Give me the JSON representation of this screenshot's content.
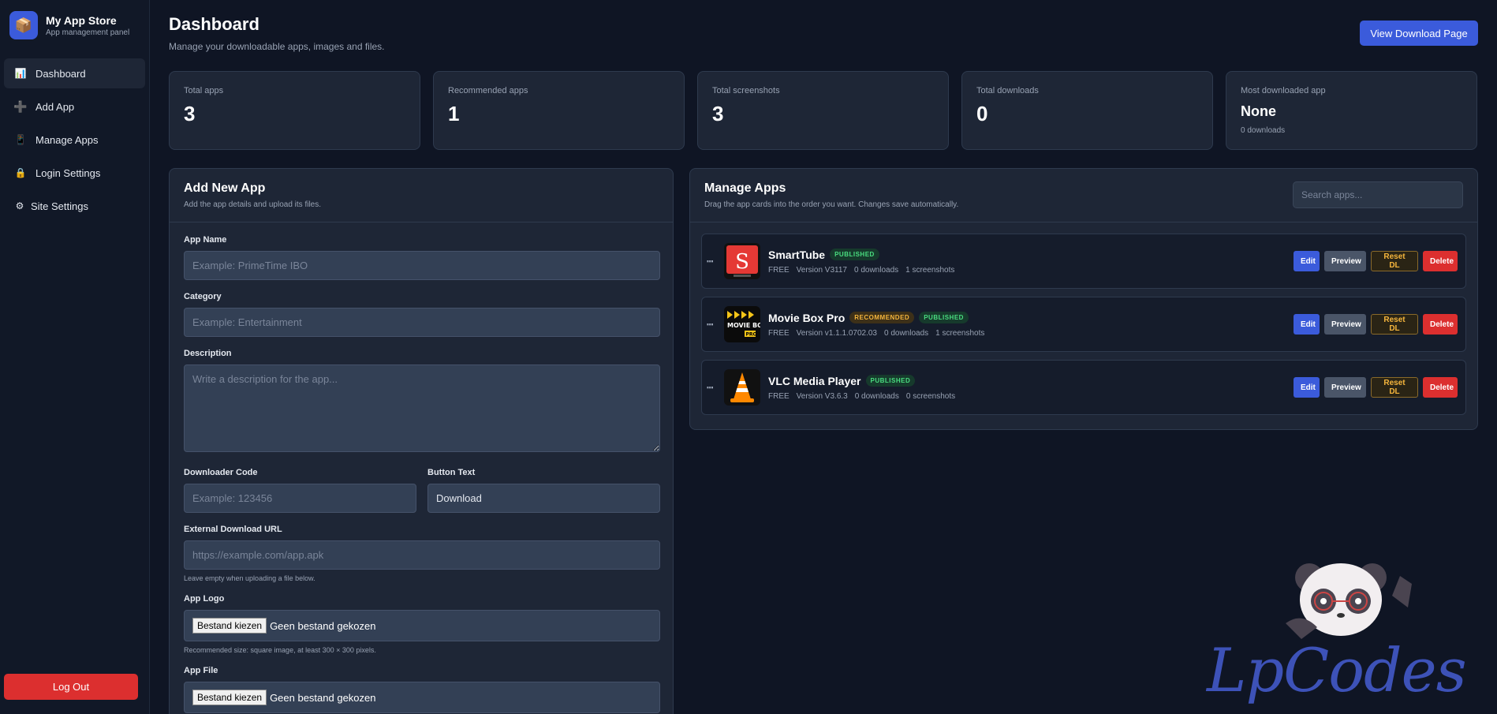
{
  "brand": {
    "title": "My App Store",
    "subtitle": "App management panel"
  },
  "nav": [
    {
      "label": "Dashboard",
      "icon": "chart-icon",
      "glyph": "📊",
      "active": true
    },
    {
      "label": "Add App",
      "icon": "plus-icon",
      "glyph": "➕"
    },
    {
      "label": "Manage Apps",
      "icon": "clipboard-icon",
      "glyph": "📱"
    },
    {
      "label": "Login Settings",
      "icon": "lock-icon",
      "glyph": "🔒"
    },
    {
      "label": "Site Settings",
      "icon": "gear-icon",
      "glyph": "⚙"
    }
  ],
  "logout_label": "Log Out",
  "header": {
    "title": "Dashboard",
    "subtitle": "Manage your downloadable apps, images and files.",
    "view_button": "View Download Page"
  },
  "stats": [
    {
      "label": "Total apps",
      "value": "3"
    },
    {
      "label": "Recommended apps",
      "value": "1"
    },
    {
      "label": "Total screenshots",
      "value": "3"
    },
    {
      "label": "Total downloads",
      "value": "0"
    },
    {
      "label": "Most downloaded app",
      "value": "None",
      "note": "0 downloads"
    }
  ],
  "add_form": {
    "title": "Add New App",
    "subtitle": "Add the app details and upload its files.",
    "app_name_label": "App Name",
    "app_name_placeholder": "Example: PrimeTime IBO",
    "category_label": "Category",
    "category_placeholder": "Example: Entertainment",
    "description_label": "Description",
    "description_placeholder": "Write a description for the app...",
    "downloader_label": "Downloader Code",
    "downloader_placeholder": "Example: 123456",
    "button_text_label": "Button Text",
    "button_text_value": "Download",
    "url_label": "External Download URL",
    "url_placeholder": "https://example.com/app.apk",
    "url_hint": "Leave empty when uploading a file below.",
    "logo_label": "App Logo",
    "file_button": "Bestand kiezen",
    "file_none": "Geen bestand gekozen",
    "logo_hint": "Recommended size: square image, at least 300 × 300 pixels.",
    "app_file_label": "App File"
  },
  "manage": {
    "title": "Manage Apps",
    "subtitle": "Drag the app cards into the order you want. Changes save automatically.",
    "search_placeholder": "Search apps...",
    "apps": [
      {
        "name": "SmartTube",
        "badges": [
          "PUBLISHED"
        ],
        "price": "FREE",
        "version": "Version V3117",
        "downloads": "0 downloads",
        "screenshots": "1 screenshots",
        "icon": "smarttube-icon"
      },
      {
        "name": "Movie Box Pro",
        "badges": [
          "RECOMMENDED",
          "PUBLISHED"
        ],
        "price": "FREE",
        "version": "Version v1.1.1.0702.03",
        "downloads": "0 downloads",
        "screenshots": "1 screenshots",
        "icon": "moviebox-icon",
        "icon_text": "MOVIE BOX",
        "icon_tag": "PRO"
      },
      {
        "name": "VLC Media Player",
        "badges": [
          "PUBLISHED"
        ],
        "price": "FREE",
        "version": "Version V3.6.3",
        "downloads": "0 downloads",
        "screenshots": "0 screenshots",
        "icon": "vlc-icon"
      }
    ],
    "actions": {
      "edit": "Edit",
      "preview": "Preview",
      "reset": "Reset DL",
      "delete": "Delete"
    }
  },
  "watermark": "LpCodes",
  "colors": {
    "accent": "#3b5bdb",
    "danger": "#dc2f2f",
    "warning": "#f5b53c",
    "success": "#4ade80",
    "background": "#0f1524",
    "panel": "#1e2636"
  }
}
